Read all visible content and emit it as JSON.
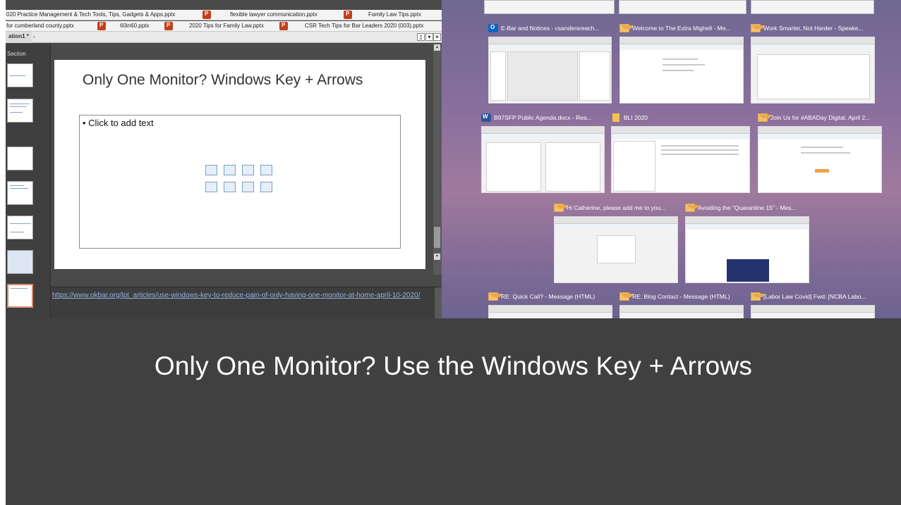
{
  "powerpoint": {
    "recent_files_row1": [
      "020 Practice Management & Tech Tools, Tips, Gadgets & Apps.pptx",
      "flexible lawyer communication.pptx",
      "Family Law Tips.pptx"
    ],
    "recent_files_row2": [
      "for cumberland county.pptx",
      "60in60.pptx",
      "2020 Tips for Family Law.pptx",
      "CSR  Tech Tips for Bar Leaders 2020 (003).pptx"
    ],
    "document_tab": "ation1 *",
    "section_label": "Section",
    "slide": {
      "title": "Only One Monitor? Windows Key + Arrows",
      "placeholder_text": "• Click to add text"
    },
    "notes_link": "https://www.okbar.org/lpt_articles/use-windows-key-to-reduce-pain-of-only-having-one-monitor-at-home-april-10-2020/"
  },
  "task_view": {
    "windows": [
      {
        "icon": "outlook-icon",
        "title": "E-Bar and Notices - csandersreach..."
      },
      {
        "icon": "mail-icon",
        "title": "Welcome to The Extra Mighell - Me..."
      },
      {
        "icon": "mail-icon",
        "title": "Work Smarter, Not Harder - Speake..."
      },
      {
        "icon": "word-icon",
        "title": "B97SFP Public Agenda.docx  -  Rea..."
      },
      {
        "icon": "folder-icon",
        "title": "BLI 2020"
      },
      {
        "icon": "mail-icon",
        "title": "Join Us for #ABADay Digital, April 2..."
      },
      {
        "icon": "mail-icon",
        "title": "Hi Catherine, please add me to you..."
      },
      {
        "icon": "mail-icon",
        "title": "Avoiding the \"Quarantine 15\" - Mes..."
      },
      {
        "icon": "mail-icon",
        "title": "RE: Quick Call? - Message (HTML)"
      },
      {
        "icon": "mail-icon",
        "title": "RE: Blog Contact - Message (HTML)"
      },
      {
        "icon": "mail-icon",
        "title": "[Labor Law Covid] Fwd: [NCBA Labo..."
      }
    ]
  },
  "caption": "Only One Monitor? Use the Windows Key + Arrows"
}
